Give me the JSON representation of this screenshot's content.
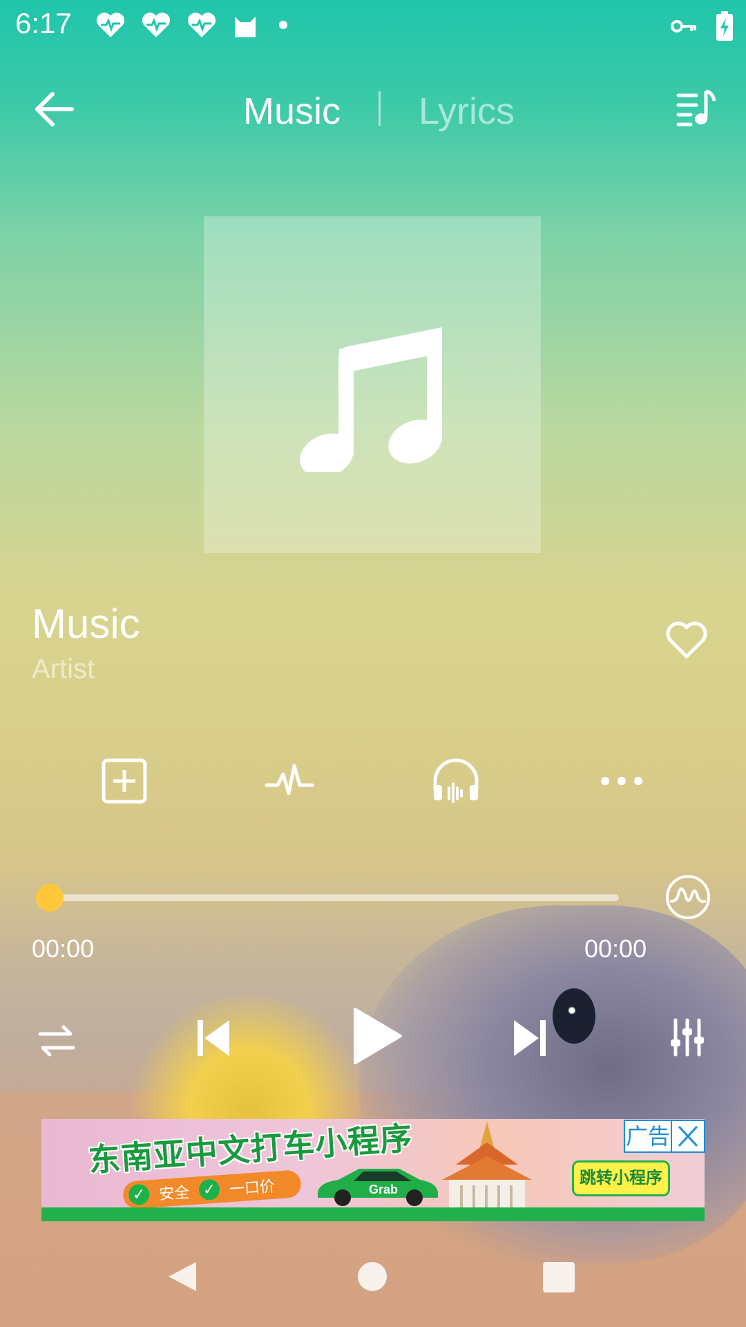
{
  "status_bar": {
    "time": "6:17",
    "icons": [
      "heart-pulse-icon",
      "heart-pulse-icon",
      "heart-pulse-icon",
      "cat-icon",
      "dot-icon"
    ],
    "right_icons": [
      "key-icon",
      "battery-charging-icon"
    ]
  },
  "header": {
    "tabs": [
      {
        "label": "Music",
        "active": true
      },
      {
        "label": "Lyrics",
        "active": false
      }
    ]
  },
  "track": {
    "title": "Music",
    "artist": "Artist"
  },
  "actions": [
    "add-to-playlist-icon",
    "waveform-icon",
    "headphones-icon",
    "more-icon"
  ],
  "progress": {
    "current": "00:00",
    "total": "00:00",
    "fraction": 0.0
  },
  "controls": [
    "repeat-icon",
    "previous-icon",
    "play-icon",
    "next-icon",
    "equalizer-icon"
  ],
  "ad": {
    "headline": "东南亚中文打车小程序",
    "badges": [
      "安全",
      "一口价"
    ],
    "brand": "Grab",
    "cta": "跳转小程序",
    "label": "广告"
  },
  "colors": {
    "accent": "#ffc83a",
    "status_bar_bg": "#20c5ab"
  }
}
